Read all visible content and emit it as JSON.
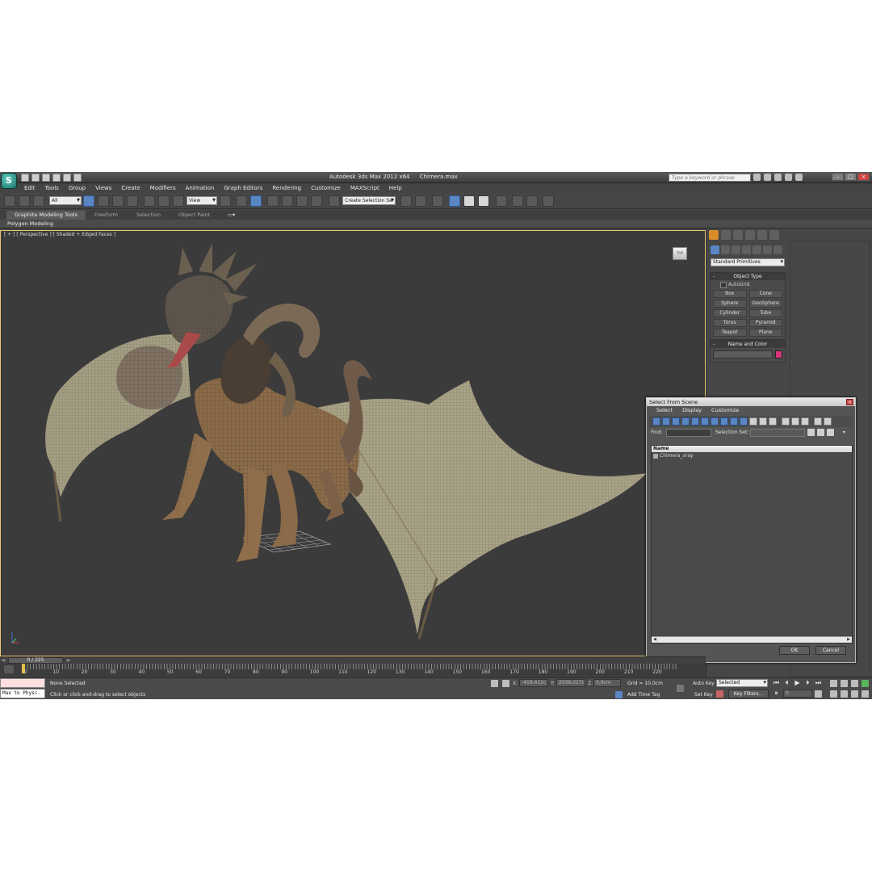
{
  "window": {
    "app_title": "Autodesk 3ds Max  2012 x64",
    "file_name": "Chimera.max",
    "search_placeholder": "Type a keyword or phrase"
  },
  "menu": [
    "Edit",
    "Tools",
    "Group",
    "Views",
    "Create",
    "Modifiers",
    "Animation",
    "Graph Editors",
    "Rendering",
    "Customize",
    "MAXScript",
    "Help"
  ],
  "toolbar": {
    "selection_filter": "All",
    "ref_coord_system": "View",
    "named_selection_set": "Create Selection Se"
  },
  "ribbon": {
    "tabs": [
      "Graphite Modeling Tools",
      "Freeform",
      "Selection",
      "Object Paint"
    ],
    "active_panel": "Polygon Modeling"
  },
  "viewport": {
    "label": "[ + ] [ Perspective ] [ Shaded + Edged Faces ]",
    "viewcube_label": "TOP"
  },
  "command_panel": {
    "category": "Standard Primitives",
    "object_type_title": "Object Type",
    "autogrid_label": "AutoGrid",
    "primitives": [
      "Box",
      "Cone",
      "Sphere",
      "GeoSphere",
      "Cylinder",
      "Tube",
      "Torus",
      "Pyramid",
      "Teapot",
      "Plane"
    ],
    "name_color_title": "Name and Color",
    "object_color": "#d4337c"
  },
  "dialog": {
    "title": "Select From Scene",
    "menu": [
      "Select",
      "Display",
      "Customize"
    ],
    "find_label": "Find:",
    "selection_set_label": "Selection Set:",
    "column_header": "Name",
    "items": [
      "Chimera_vray"
    ],
    "ok_label": "OK",
    "cancel_label": "Cancel"
  },
  "timeline": {
    "frame_display": "0 / 225",
    "tick_labels": [
      "0",
      "10",
      "20",
      "30",
      "40",
      "50",
      "60",
      "70",
      "80",
      "90",
      "100",
      "110",
      "120",
      "130",
      "140",
      "150",
      "160",
      "170",
      "180",
      "190",
      "200",
      "210",
      "220"
    ]
  },
  "status": {
    "maxscript_text": "Max to Physc.",
    "selection_status": "None Selected",
    "prompt": "Click or click-and-drag to select objects",
    "x_label": "X:",
    "x_value": "-418,412c",
    "y_label": "Y:",
    "y_value": "2036,017c",
    "z_label": "Z:",
    "z_value": "0,0cm",
    "grid": "Grid = 10,0cm",
    "add_time_tag": "Add Time Tag",
    "auto_key": "Auto Key",
    "set_key": "Set Key",
    "key_mode": "Selected",
    "key_filters": "Key Filters...",
    "current_frame": "0"
  }
}
